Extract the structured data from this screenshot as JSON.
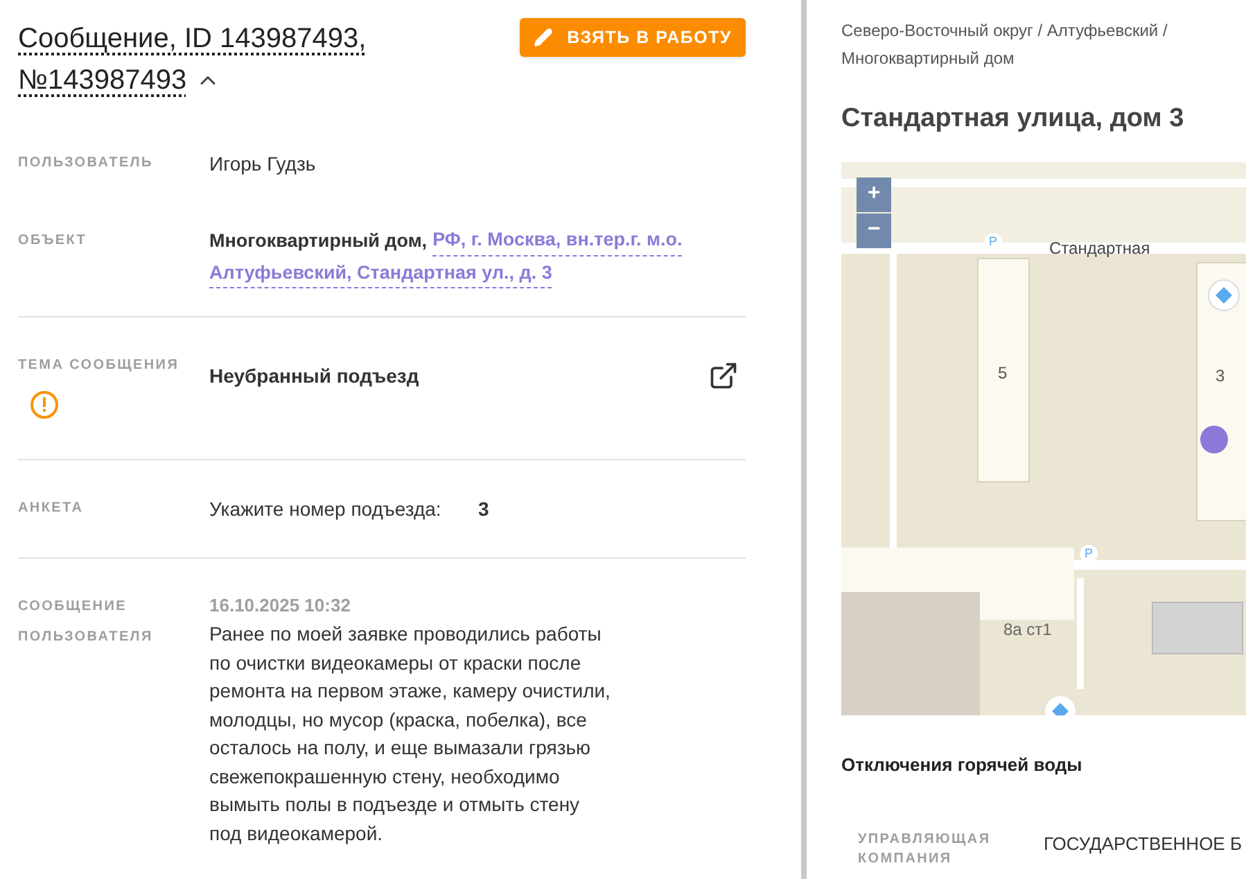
{
  "header": {
    "title_line1": "Сообщение, ID 143987493,",
    "title_line2": "№143987493",
    "expanded": true,
    "action_button": "ВЗЯТЬ В РАБОТУ"
  },
  "fields": [
    {
      "kind": "text",
      "label": "ПОЛЬЗОВАТЕЛЬ",
      "value": "Игорь Гудзь"
    },
    {
      "kind": "object",
      "label": "ОБЪЕКТ",
      "type": "Многоквартирный дом,",
      "address_lines": [
        "РФ, г. Москва, вн.тер.г. м.о.",
        "Алтуфьевский, Стандартная ул., д. 3"
      ]
    },
    {
      "kind": "topic",
      "label": "ТЕМА СООБЩЕНИЯ",
      "value": "Неубранный подъезд"
    },
    {
      "kind": "survey",
      "label": "АНКЕТА",
      "question": "Укажите номер подъезда:",
      "answer": "3"
    },
    {
      "kind": "message",
      "label": "СООБЩЕНИЕ ПОЛЬЗОВАТЕЛЯ",
      "date": "16.10.2025 10:32",
      "value": "Ранее по моей заявке проводились работы по очистки видеокамеры от краски после ремонта на первом этаже, камеру очистили, молодцы, но мусор (краска, побелка), все осталось на полу, и еще вымазали грязью свежепокрашенную стену, необходимо вымыть полы в подъезде и отмыть стену под видеокамерой."
    }
  ],
  "building": {
    "breadcrumb": "Северо-Восточный округ / Алтуфьевский / Многоквартирный дом",
    "title": "Стандартная улица, дом 3",
    "map": {
      "zoom_in": "+",
      "zoom_out": "−",
      "street_label": "Стандартная",
      "house_labels": [
        "5",
        "3",
        "8а ст1"
      ],
      "parking_labels": [
        "P",
        "P"
      ]
    },
    "section_title": "Отключения горячей воды",
    "management": {
      "label": "УПРАВЛЯЮЩАЯ КОМПАНИЯ",
      "value": "ГОСУДАРСТВЕННОЕ Б"
    }
  }
}
